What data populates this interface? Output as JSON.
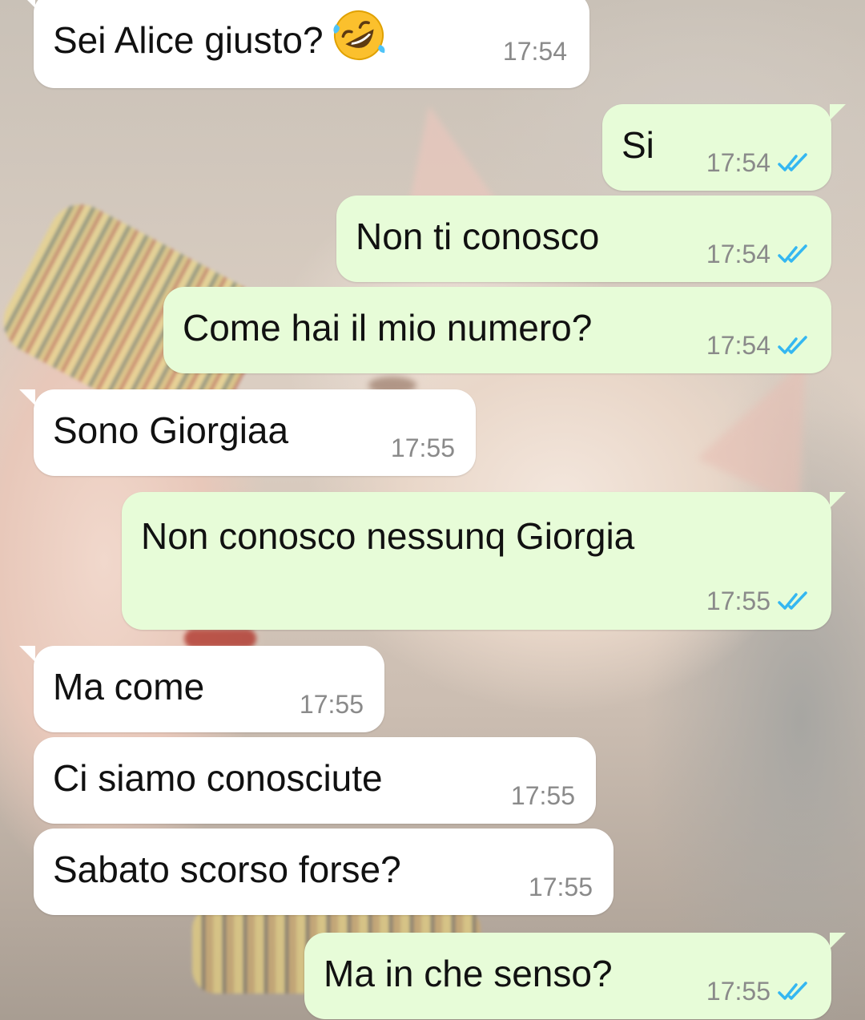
{
  "colors": {
    "incoming_bg": "#ffffff",
    "outgoing_bg": "#e7fcd8",
    "read_ticks": "#34b7f1",
    "timestamp": "#8a8a8a"
  },
  "messages": [
    {
      "dir": "in",
      "text": "Sei Alice giusto?",
      "emoji": "rolling-on-floor-laughing",
      "time": "17:54"
    },
    {
      "dir": "out",
      "text": "Si",
      "time": "17:54",
      "status": "read"
    },
    {
      "dir": "out",
      "text": "Non ti conosco",
      "time": "17:54",
      "status": "read"
    },
    {
      "dir": "out",
      "text": "Come hai il mio numero?",
      "time": "17:54",
      "status": "read"
    },
    {
      "dir": "in",
      "text": "Sono Giorgiaa",
      "time": "17:55"
    },
    {
      "dir": "out",
      "text": "Non conosco nessunq Giorgia",
      "time": "17:55",
      "status": "read"
    },
    {
      "dir": "in",
      "text": "Ma come",
      "time": "17:55"
    },
    {
      "dir": "in",
      "text": "Ci siamo conosciute",
      "time": "17:55"
    },
    {
      "dir": "in",
      "text": "Sabato scorso forse?",
      "time": "17:55"
    },
    {
      "dir": "out",
      "text": "Ma in che senso?",
      "time": "17:55",
      "status": "read"
    }
  ]
}
